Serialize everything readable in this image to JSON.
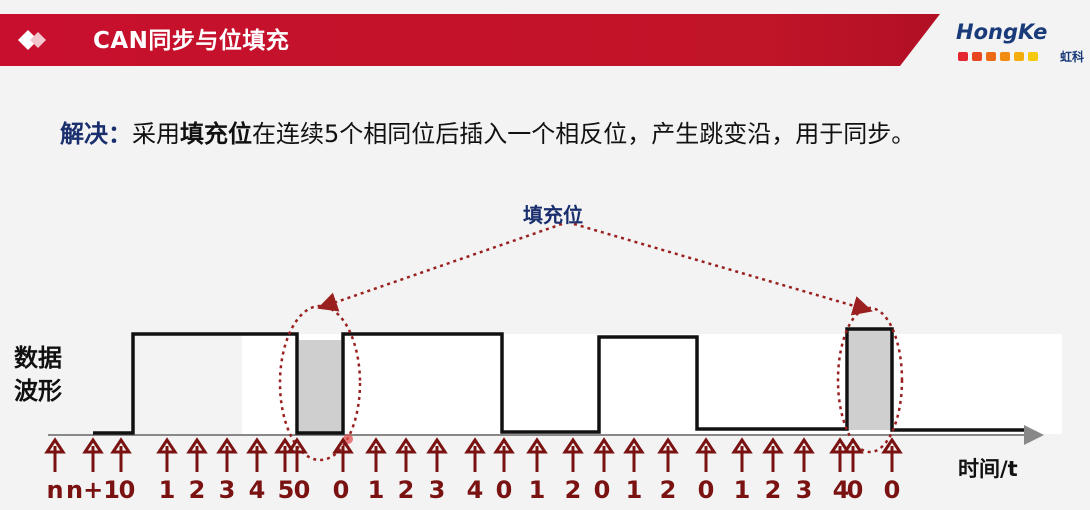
{
  "header": {
    "title": "CAN同步与位填充",
    "brand_name": "HongKe",
    "brand_cn": "虹科",
    "brand_dot_colors": [
      "#e3262f",
      "#e8461f",
      "#ec6a16",
      "#f08c12",
      "#f4ad0e",
      "#f7c90b"
    ],
    "accent_color": "#c8102e"
  },
  "solution": {
    "lead": "解决：",
    "part1": "采用",
    "highlight": "填充位",
    "part2": "在连续5个相同位后插入一个相反位，产生跳变沿，用于同步。"
  },
  "diagram": {
    "callout_label": "填充位",
    "y_axis_label": "数据波形",
    "x_axis_label": "时间/t",
    "tick_labels": [
      "n",
      "n+1",
      "0",
      "1",
      "2",
      "3",
      "4",
      "5",
      "0",
      "0",
      "1",
      "2",
      "3",
      "4",
      "0",
      "1",
      "2",
      "0",
      "1",
      "2",
      "0",
      "1",
      "2",
      "3",
      "4",
      "0",
      "0"
    ],
    "arrow_color": "#7a1212",
    "highlight_color": "#9a2020"
  }
}
